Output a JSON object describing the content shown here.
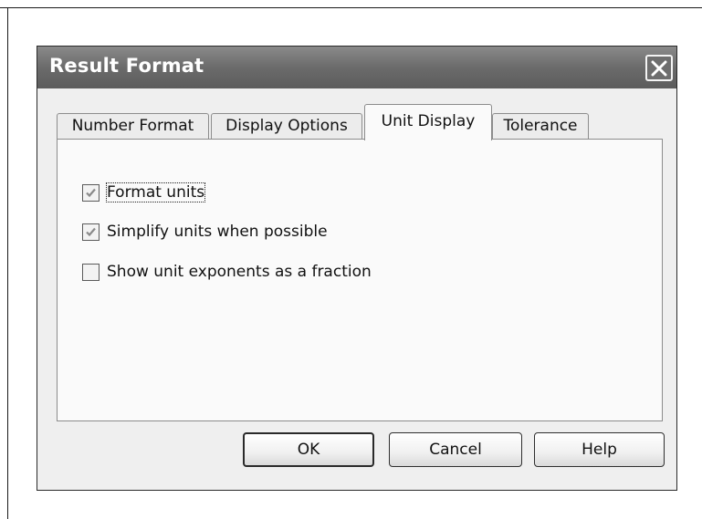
{
  "dialog": {
    "title": "Result Format",
    "close_icon": "close-icon"
  },
  "tabs": [
    {
      "label": "Number Format",
      "active": false
    },
    {
      "label": "Display Options",
      "active": false
    },
    {
      "label": "Unit Display",
      "active": true
    },
    {
      "label": "Tolerance",
      "active": false
    }
  ],
  "options": [
    {
      "label": "Format units",
      "checked": true,
      "icon": "checkmark-icon"
    },
    {
      "label": "Simplify units when possible",
      "checked": true,
      "icon": "checkmark-icon"
    },
    {
      "label": "Show unit exponents as a fraction",
      "checked": false
    }
  ],
  "buttons": {
    "ok": "OK",
    "cancel": "Cancel",
    "help": "Help"
  }
}
